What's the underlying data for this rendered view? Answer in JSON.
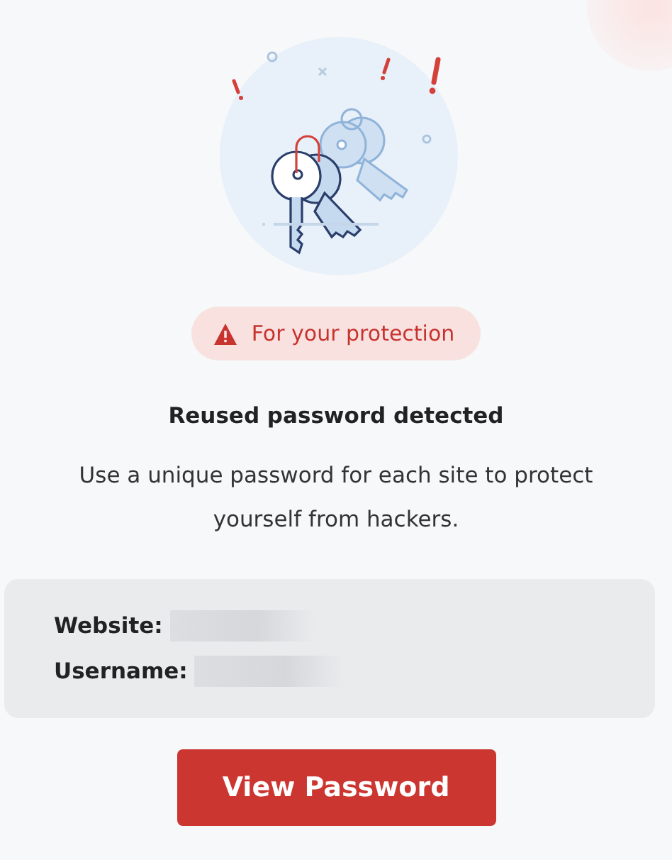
{
  "badge": {
    "text": "For your protection"
  },
  "title": "Reused password detected",
  "message": "Use a unique password for each site to protect yourself from hackers.",
  "details": [
    {
      "label": "Website:"
    },
    {
      "label": "Username:"
    }
  ],
  "button": {
    "label": "View Password"
  }
}
